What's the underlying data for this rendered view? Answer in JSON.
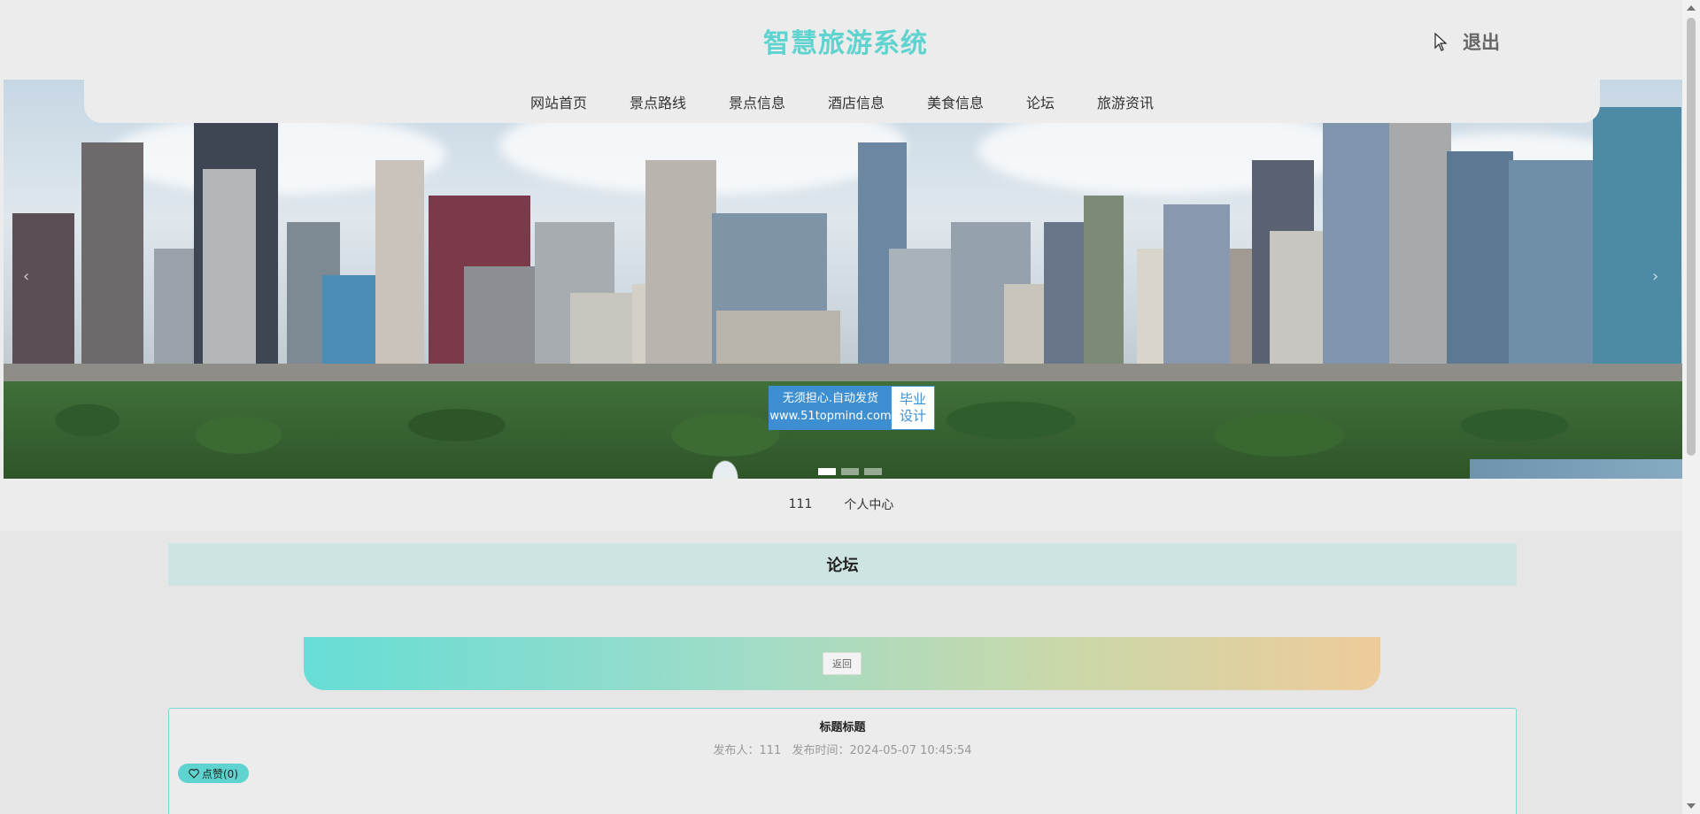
{
  "header": {
    "site_title": "智慧旅游系统",
    "logout_label": "退出"
  },
  "nav": {
    "items": [
      "网站首页",
      "景点路线",
      "景点信息",
      "酒店信息",
      "美食信息",
      "论坛",
      "旅游资讯"
    ]
  },
  "banner": {
    "watermark_line1": "无须担心.自动发货",
    "watermark_line2": "www.51topmind.com",
    "watermark_right1": "毕业",
    "watermark_right2": "设计",
    "prev_icon": "chevron-left-icon",
    "next_icon": "chevron-right-icon",
    "slides": 3,
    "active_slide": 1
  },
  "subnav": {
    "username": "111",
    "personal_center": "个人中心"
  },
  "section": {
    "title": "论坛"
  },
  "actions": {
    "back_label": "返回"
  },
  "post": {
    "title": "标题标题",
    "author_label": "发布人：111",
    "time_label": "发布时间：2024-05-07 10:45:54",
    "like_label": "点赞(0)",
    "like_icon": "heart-icon"
  },
  "colors": {
    "accent": "#5fd3cf",
    "section_bg": "#cde4e2",
    "watermark_blue": "#3d8fd1"
  }
}
